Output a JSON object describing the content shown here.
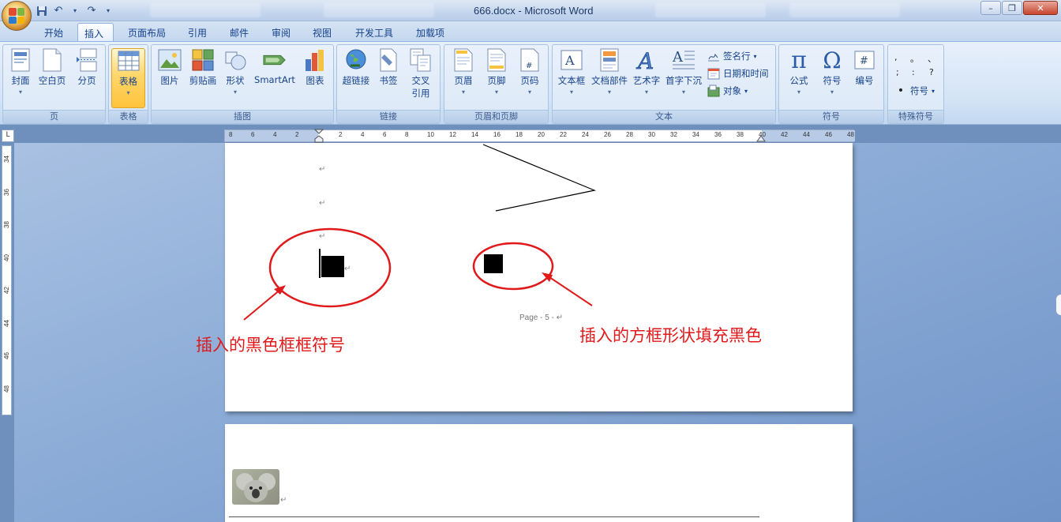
{
  "window": {
    "title": "666.docx - Microsoft Word",
    "minimize_label": "–",
    "maximize_label": "❐",
    "close_label": "✕"
  },
  "tabs": [
    "开始",
    "插入",
    "页面布局",
    "引用",
    "邮件",
    "审阅",
    "视图",
    "开发工具",
    "加载项"
  ],
  "active_tab": "插入",
  "ribbon": {
    "groups": {
      "pages": "页",
      "tables": "表格",
      "illustrations": "插图",
      "links": "链接",
      "header_footer": "页眉和页脚",
      "text": "文本",
      "symbols": "符号",
      "special_symbols": "特殊符号"
    },
    "buttons": {
      "cover": "封面",
      "blank_page": "空白页",
      "page_break": "分页",
      "table": "表格",
      "picture": "图片",
      "clipart": "剪贴画",
      "shapes": "形状",
      "smartart": "SmartArt",
      "chart": "图表",
      "hyperlink": "超链接",
      "bookmark": "书签",
      "cross_ref_1": "交叉",
      "cross_ref_2": "引用",
      "header": "页眉",
      "footer": "页脚",
      "page_number": "页码",
      "textbox": "文本框",
      "quick_parts": "文档部件",
      "wordart": "艺术字",
      "dropcap": "首字下沉",
      "signature_line": "签名行",
      "date_time": "日期和时间",
      "object": "对象",
      "equation": "公式",
      "symbol": "符号",
      "numbering": "编号",
      "special_symbol": "符号"
    },
    "special_chars": [
      ",",
      "。",
      "、",
      ";",
      ":",
      "?"
    ]
  },
  "ruler": {
    "h_numbers": [
      "8",
      "6",
      "4",
      "2",
      "2",
      "4",
      "6",
      "8",
      "10",
      "12",
      "14",
      "16",
      "18",
      "20",
      "22",
      "24",
      "26",
      "28",
      "30",
      "32",
      "34",
      "36",
      "38",
      "40",
      "42",
      "44",
      "46",
      "48"
    ],
    "v_numbers": [
      "34",
      "36",
      "38",
      "40",
      "42",
      "44",
      "46",
      "48"
    ],
    "corner_label": "L"
  },
  "document": {
    "page_footer": "Page - 5 -",
    "para_mark": "↵",
    "annotation_left": "插入的黑色框框符号",
    "annotation_right": "插入的方框形状填充黑色"
  },
  "colors": {
    "annotation": "#e0191b",
    "ribbon_highlight": "#ffd66b",
    "workspace": "#8eaed8"
  }
}
